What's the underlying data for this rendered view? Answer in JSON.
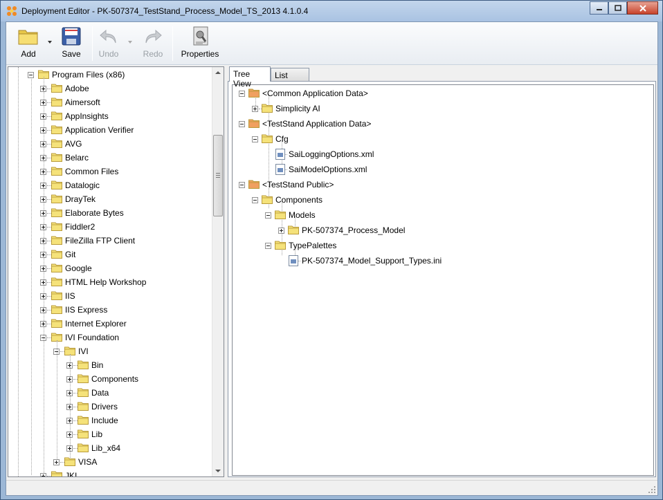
{
  "window": {
    "title": "Deployment Editor - PK-507374_TestStand_Process_Model_TS_2013 4.1.0.4"
  },
  "toolbar": {
    "add_label": "Add",
    "save_label": "Save",
    "undo_label": "Undo",
    "redo_label": "Redo",
    "properties_label": "Properties"
  },
  "left_tree": {
    "root": {
      "label": "Program Files (x86)"
    },
    "items": [
      {
        "label": "Adobe"
      },
      {
        "label": "Aimersoft"
      },
      {
        "label": "AppInsights"
      },
      {
        "label": "Application Verifier"
      },
      {
        "label": "AVG"
      },
      {
        "label": "Belarc"
      },
      {
        "label": "Common Files"
      },
      {
        "label": "Datalogic"
      },
      {
        "label": "DrayTek"
      },
      {
        "label": "Elaborate Bytes"
      },
      {
        "label": "Fiddler2"
      },
      {
        "label": "FileZilla FTP Client"
      },
      {
        "label": "Git"
      },
      {
        "label": "Google"
      },
      {
        "label": "HTML Help Workshop"
      },
      {
        "label": "IIS"
      },
      {
        "label": "IIS Express"
      },
      {
        "label": "Internet Explorer"
      },
      {
        "label": "IVI Foundation"
      }
    ],
    "ivi": {
      "label": "IVI"
    },
    "ivi_children": [
      {
        "label": "Bin"
      },
      {
        "label": "Components"
      },
      {
        "label": "Data"
      },
      {
        "label": "Drivers"
      },
      {
        "label": "Include"
      },
      {
        "label": "Lib"
      },
      {
        "label": "Lib_x64"
      }
    ],
    "visa": {
      "label": "VISA"
    },
    "jki": {
      "label": "JKI"
    }
  },
  "right_tabs": {
    "tree_view": "Tree View",
    "list_view": "List View"
  },
  "right_tree": {
    "common_app_data": "<Common Application Data>",
    "simplicity_ai": "Simplicity AI",
    "teststand_app_data": "<TestStand Application Data>",
    "cfg": "Cfg",
    "sai_logging": "SaiLoggingOptions.xml",
    "sai_model": "SaiModelOptions.xml",
    "teststand_public": "<TestStand Public>",
    "components": "Components",
    "models": "Models",
    "process_model": "PK-507374_Process_Model",
    "type_palettes": "TypePalettes",
    "support_types": "PK-507374_Model_Support_Types.ini"
  },
  "colors": {
    "folder_yellow": "#f5e27a",
    "folder_orange": "#f0a060",
    "title_bar": "#b6cbe6",
    "close_red": "#c7432b"
  }
}
